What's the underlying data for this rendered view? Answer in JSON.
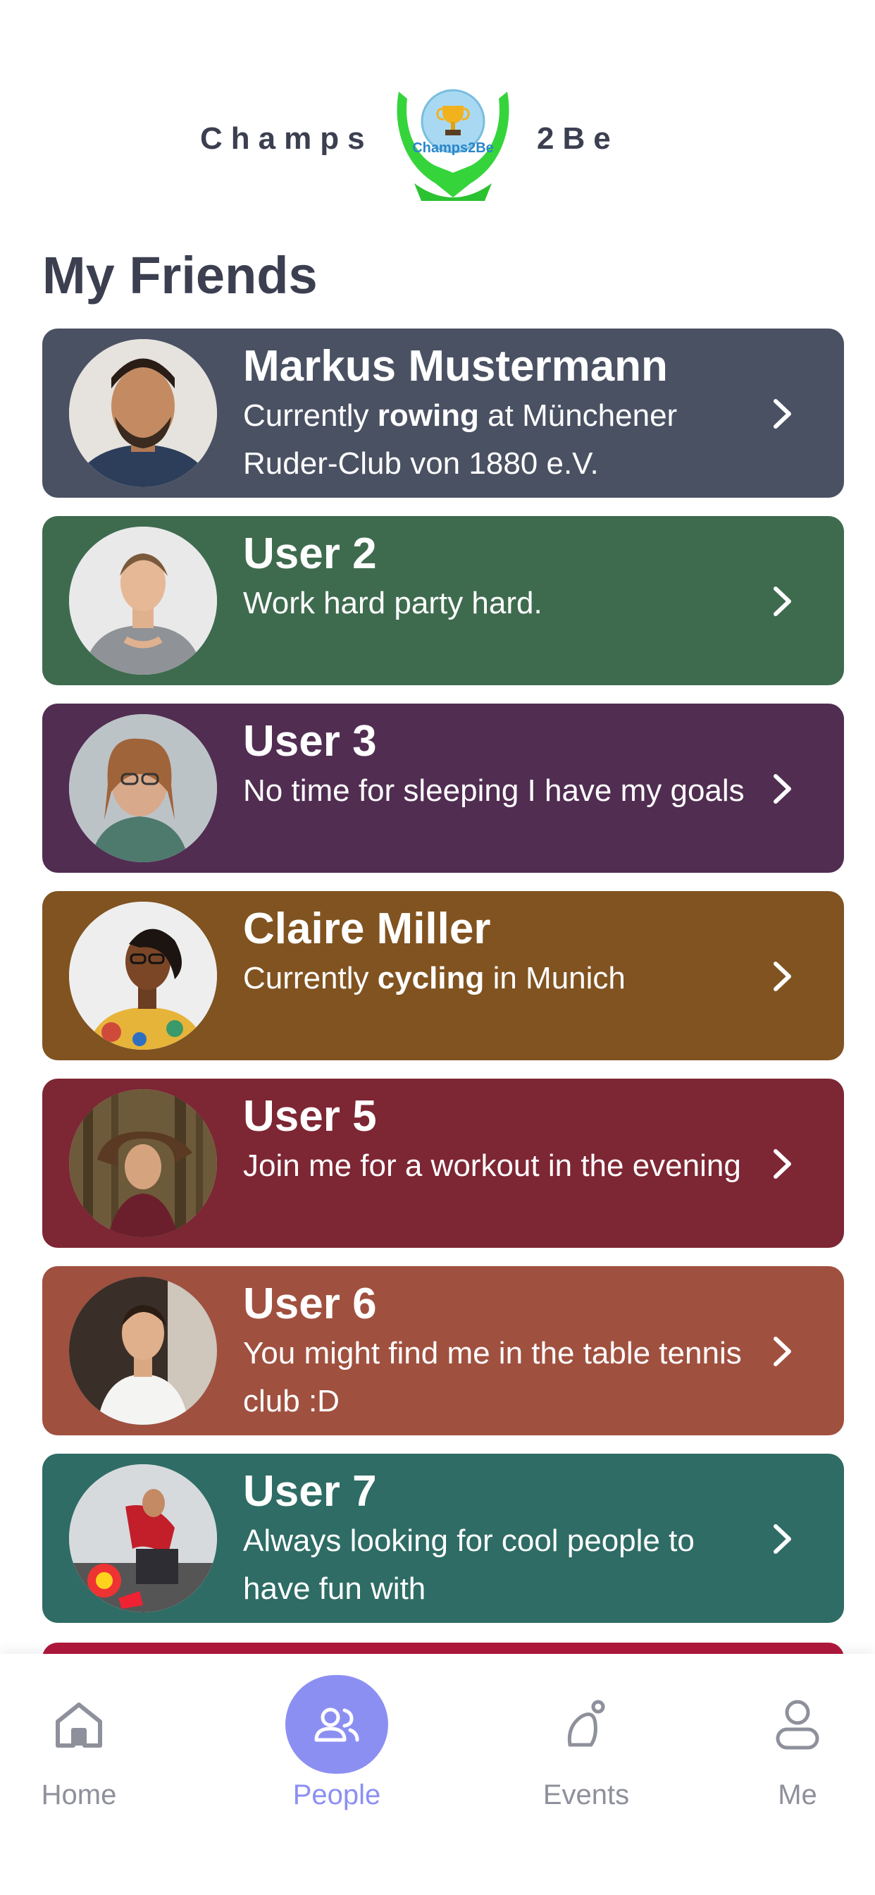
{
  "brand": {
    "left": "Champs",
    "right": "2Be",
    "logo_text": "Champs2Be"
  },
  "title": "My Friends",
  "friends": [
    {
      "name": "Markus Mustermann",
      "color": "#4a5163",
      "status_pre": "Currently ",
      "status_bold": "rowing",
      "status_post": " at Münchener Ruder-Club von 1880 e.V.",
      "avatar": "man-beard-avatar"
    },
    {
      "name": "User 2",
      "color": "#3e6b4e",
      "status_pre": "Work hard party hard.",
      "status_bold": "",
      "status_post": "",
      "avatar": "man-gray-shirt-avatar"
    },
    {
      "name": "User 3",
      "color": "#512d52",
      "status_pre": "No time for sleeping I have my goals",
      "status_bold": "",
      "status_post": "",
      "avatar": "woman-glasses-avatar"
    },
    {
      "name": "Claire Miller",
      "color": "#805320",
      "status_pre": "Currently ",
      "status_bold": "cycling",
      "status_post": " in Munich",
      "avatar": "woman-floral-avatar"
    },
    {
      "name": "User 5",
      "color": "#7d2634",
      "status_pre": "Join me for a workout in the evening",
      "status_bold": "",
      "status_post": "",
      "avatar": "woman-forest-avatar"
    },
    {
      "name": "User 6",
      "color": "#a0503f",
      "status_pre": "You might find me in the table tennis club :D",
      "status_bold": "",
      "status_post": "",
      "avatar": "man-white-tee-avatar"
    },
    {
      "name": "User 7",
      "color": "#2e6c65",
      "status_pre": "Always looking for cool people to have fun with",
      "status_bold": "",
      "status_post": "",
      "avatar": "man-gym-avatar"
    }
  ],
  "tabs": [
    {
      "label": "Home",
      "icon": "home-icon",
      "active": false
    },
    {
      "label": "People",
      "icon": "people-icon",
      "active": true
    },
    {
      "label": "Events",
      "icon": "events-icon",
      "active": false
    },
    {
      "label": "Me",
      "icon": "user-icon",
      "active": false
    }
  ],
  "colors": {
    "accent": "#8c8ff2",
    "text_dark": "#3b3f50",
    "tab_inactive": "#8e909b",
    "next_card": "#b0183d"
  }
}
